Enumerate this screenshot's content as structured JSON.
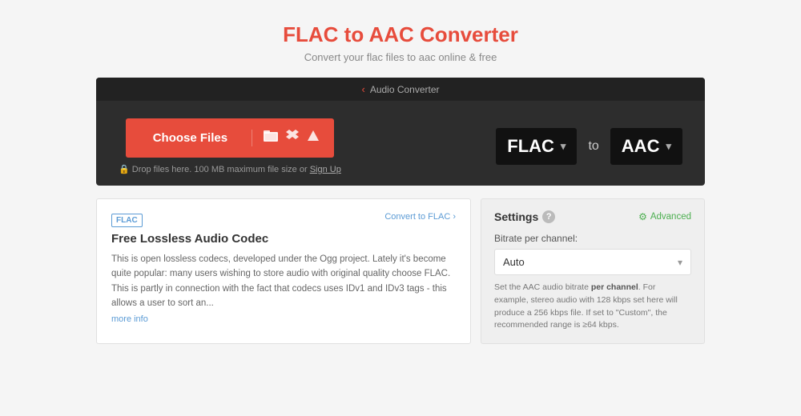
{
  "header": {
    "title": "FLAC to AAC Converter",
    "subtitle": "Convert your flac files to aac online & free"
  },
  "topbar": {
    "label": "Audio Converter"
  },
  "choose_files": {
    "button_label": "Choose Files",
    "drop_hint": "Drop files here. 100 MB maximum file size or",
    "signup_link": "Sign Up",
    "icons": {
      "folder": "📁",
      "dropbox": "❐",
      "drive": "▲"
    }
  },
  "format_selector": {
    "source_format": "FLAC",
    "to_label": "to",
    "target_format": "AAC"
  },
  "left_panel": {
    "badge": "FLAC",
    "convert_link": "Convert to FLAC  ›",
    "title": "Free Lossless Audio Codec",
    "description": "This is open lossless codecs, developed under the Ogg project. Lately it's become quite popular: many users wishing to store audio with original quality choose FLAC. This is partly in connection with the fact that codecs uses IDv1 and IDv3 tags - this allows a user to sort an...",
    "more_info": "more info"
  },
  "right_panel": {
    "settings_title": "Settings",
    "help_label": "?",
    "advanced_label": "Advanced",
    "bitrate_label": "Bitrate per channel:",
    "bitrate_value": "Auto",
    "bitrate_hint": "Set the AAC audio bitrate per channel. For example, stereo audio with 128 kbps set here will produce a 256 kbps file. If set to \"Custom\", the recommended range is ≥64 kbps."
  },
  "colors": {
    "accent": "#e74c3c",
    "link": "#5b9bd5",
    "advanced": "#4caf50",
    "dark_bg": "#2d2d2d",
    "darker_bg": "#222",
    "format_bg": "#111"
  }
}
